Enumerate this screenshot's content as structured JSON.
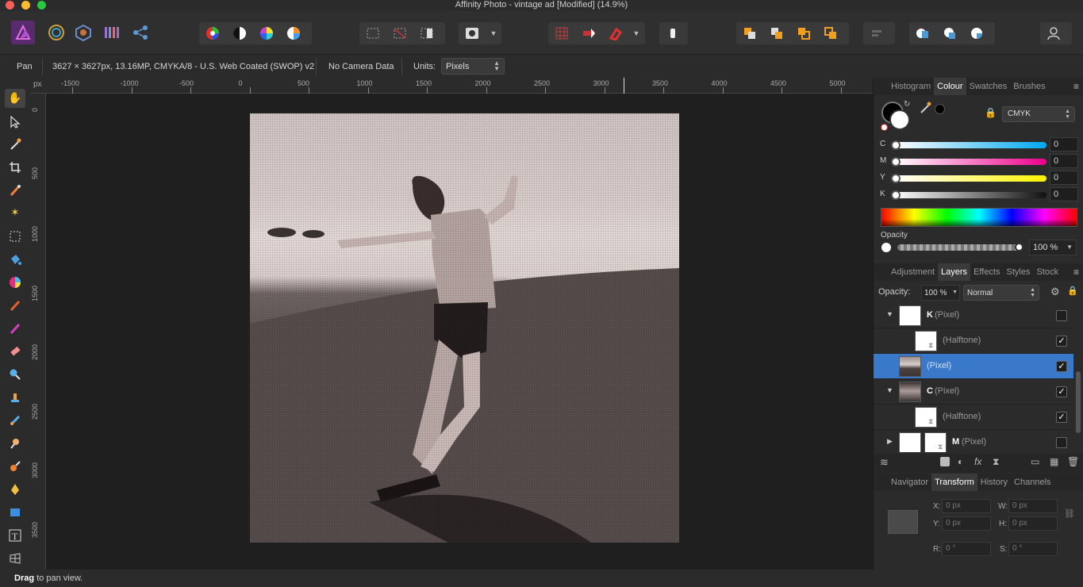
{
  "window": {
    "title": "Affinity Photo - vintage ad [Modified] (14.9%)"
  },
  "context_bar": {
    "tool_name": "Pan",
    "doc_info": "3627 × 3627px, 13.16MP, CMYKA/8 - U.S. Web Coated (SWOP) v2",
    "camera": "No Camera Data",
    "units_label": "Units:",
    "units_value": "Pixels"
  },
  "ruler": {
    "unit": "px",
    "h_ticks": [
      "-1500",
      "-1000",
      "-500",
      "0",
      "500",
      "1000",
      "1500",
      "2000",
      "2500",
      "3000",
      "3500",
      "4000",
      "4500",
      "5000"
    ],
    "v_ticks": [
      "0",
      "500",
      "1000",
      "1500",
      "2000",
      "2500",
      "3000",
      "3500"
    ]
  },
  "colour_panel": {
    "tabs": [
      "Histogram",
      "Colour",
      "Swatches",
      "Brushes"
    ],
    "active_tab": "Colour",
    "model": "CMYK",
    "channels": [
      {
        "label": "C",
        "value": "0"
      },
      {
        "label": "M",
        "value": "0"
      },
      {
        "label": "Y",
        "value": "0"
      },
      {
        "label": "K",
        "value": "0"
      }
    ],
    "opacity_label": "Opacity",
    "opacity_value": "100 %"
  },
  "layers_panel": {
    "tabs": [
      "Adjustment",
      "Layers",
      "Effects",
      "Styles",
      "Stock"
    ],
    "active_tab": "Layers",
    "opacity_label": "Opacity:",
    "opacity_value": "100 %",
    "blend_mode": "Normal",
    "layers": [
      {
        "name": "K",
        "type": "(Pixel)",
        "checked": ""
      },
      {
        "name": "",
        "type": "(Halftone)",
        "checked": "✓"
      },
      {
        "name": "",
        "type": "(Pixel)",
        "checked": "✓"
      },
      {
        "name": "C",
        "type": "(Pixel)",
        "checked": "✓"
      },
      {
        "name": "",
        "type": "(Halftone)",
        "checked": "✓"
      },
      {
        "name": "M",
        "type": "(Pixel)",
        "checked": ""
      }
    ]
  },
  "transform_panel": {
    "tabs": [
      "Navigator",
      "Transform",
      "History",
      "Channels"
    ],
    "active_tab": "Transform",
    "x_label": "X:",
    "x_value": "0 px",
    "y_label": "Y:",
    "y_value": "0 px",
    "w_label": "W:",
    "w_value": "0 px",
    "h_label": "H:",
    "h_value": "0 px",
    "r_label": "R:",
    "r_value": "0 °",
    "s_label": "S:",
    "s_value": "0 °"
  },
  "status": {
    "bold": "Drag",
    "rest": " to pan view."
  }
}
